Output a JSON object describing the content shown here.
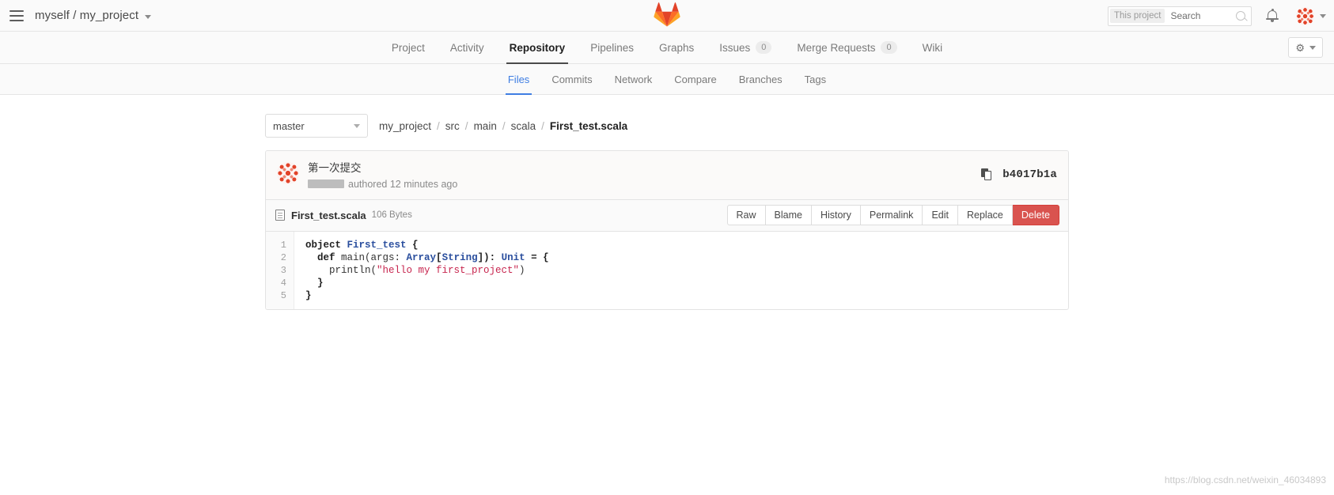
{
  "navbar": {
    "hamburger_label": "menu",
    "project_title": "myself / my_project",
    "search": {
      "scope_label": "This project",
      "placeholder": "Search",
      "value": ""
    },
    "notifications_label": "Notifications",
    "logo_label": "GitLab"
  },
  "main_nav": {
    "items": [
      {
        "label": "Project",
        "badge": "",
        "active": false
      },
      {
        "label": "Activity",
        "badge": "",
        "active": false
      },
      {
        "label": "Repository",
        "badge": "",
        "active": true
      },
      {
        "label": "Pipelines",
        "badge": "",
        "active": false
      },
      {
        "label": "Graphs",
        "badge": "",
        "active": false
      },
      {
        "label": "Issues",
        "badge": "0",
        "active": false
      },
      {
        "label": "Merge Requests",
        "badge": "0",
        "active": false
      },
      {
        "label": "Wiki",
        "badge": "",
        "active": false
      }
    ],
    "settings_icon": "gear-icon"
  },
  "sub_nav": {
    "items": [
      {
        "label": "Files",
        "active": true
      },
      {
        "label": "Commits",
        "active": false
      },
      {
        "label": "Network",
        "active": false
      },
      {
        "label": "Compare",
        "active": false
      },
      {
        "label": "Branches",
        "active": false
      },
      {
        "label": "Tags",
        "active": false
      }
    ]
  },
  "file_bar": {
    "branch": "master",
    "breadcrumb": [
      {
        "label": "my_project",
        "current": false
      },
      {
        "label": "src",
        "current": false
      },
      {
        "label": "main",
        "current": false
      },
      {
        "label": "scala",
        "current": false
      },
      {
        "label": "First_test.scala",
        "current": true
      }
    ],
    "separator": "/"
  },
  "commit": {
    "message": "第一次提交",
    "author_redacted": true,
    "authored_text": "authored 12 minutes ago",
    "sha": "b4017b1a",
    "copy_icon": "copy-icon"
  },
  "file_header": {
    "filename": "First_test.scala",
    "filesize": "106 Bytes",
    "actions": [
      {
        "label": "Raw",
        "style": "default"
      },
      {
        "label": "Blame",
        "style": "default"
      },
      {
        "label": "History",
        "style": "default"
      },
      {
        "label": "Permalink",
        "style": "default"
      },
      {
        "label": "Edit",
        "style": "default"
      },
      {
        "label": "Replace",
        "style": "default"
      },
      {
        "label": "Delete",
        "style": "danger"
      }
    ]
  },
  "code": {
    "line_numbers": [
      "1",
      "2",
      "3",
      "4",
      "5"
    ],
    "lines": [
      [
        {
          "t": "object ",
          "c": "kw"
        },
        {
          "t": "First_test",
          "c": "typ"
        },
        {
          "t": " {",
          "c": "kw"
        }
      ],
      [
        {
          "t": "  def ",
          "c": "kw"
        },
        {
          "t": "main(args: ",
          "c": "pl"
        },
        {
          "t": "Array",
          "c": "typ"
        },
        {
          "t": "[",
          "c": "kw"
        },
        {
          "t": "String",
          "c": "typ"
        },
        {
          "t": "]): ",
          "c": "kw"
        },
        {
          "t": "Unit",
          "c": "typ"
        },
        {
          "t": " = {",
          "c": "kw"
        }
      ],
      [
        {
          "t": "    println(",
          "c": "pl"
        },
        {
          "t": "\"hello my first_project\"",
          "c": "str"
        },
        {
          "t": ")",
          "c": "pl"
        }
      ],
      [
        {
          "t": "  }",
          "c": "kw"
        }
      ],
      [
        {
          "t": "}",
          "c": "kw"
        }
      ]
    ],
    "plain_text": "object First_test {\n  def main(args: Array[String]): Unit = {\n    println(\"hello my first_project\")\n  }\n}"
  },
  "watermark": "https://blog.csdn.net/weixin_46034893",
  "colors": {
    "accent_blue": "#3f7ee3",
    "brand_orange": "#e24329",
    "danger_red": "#d9534f",
    "string_red": "#c7254e",
    "type_blue": "#2b4f9e"
  }
}
